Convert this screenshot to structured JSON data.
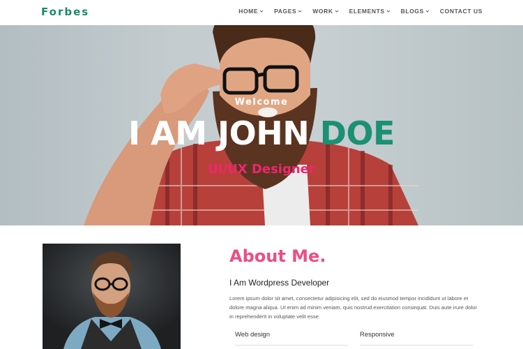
{
  "brand": {
    "logo": "Forbes"
  },
  "nav": {
    "items": [
      {
        "label": "HOME",
        "dropdown": true
      },
      {
        "label": "PAGES",
        "dropdown": true
      },
      {
        "label": "WORK",
        "dropdown": true
      },
      {
        "label": "ELEMENTS",
        "dropdown": true
      },
      {
        "label": "BLOGS",
        "dropdown": true
      },
      {
        "label": "CONTACT US",
        "dropdown": false
      }
    ]
  },
  "hero": {
    "welcome": "Welcome",
    "title_main": "I AM JOHN ",
    "title_accent": "DOE",
    "subtitle": "UI/UX Designer"
  },
  "about": {
    "title": "About Me.",
    "subtitle": "I Am Wordpress Developer",
    "text": "Lorem ipsum dolor sit amet, consectetur adipisicing elit, sed do eiusmod tempor incididunt ut labore et dolore magna aliqua. Ut enim ad minim veniam, quis nostrud exercitation consequat. Duis aute irure dolor in reprehenderit in voluptate velit esse.",
    "skills": [
      "Web design",
      "Responsive"
    ]
  },
  "colors": {
    "brand_green": "#1a8a6a",
    "accent_green": "#1a9173",
    "accent_pink": "#f0256f",
    "about_pink": "#ec4d84"
  }
}
